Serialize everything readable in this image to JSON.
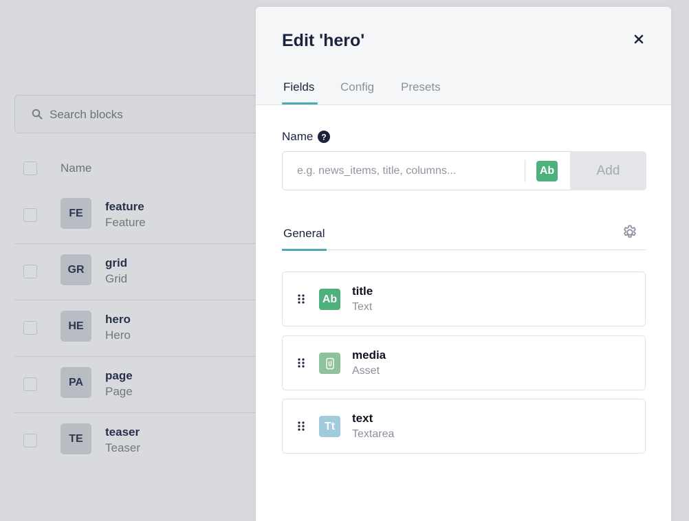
{
  "background": {
    "search": {
      "placeholder": "Search blocks"
    },
    "list_header": {
      "name_label": "Name"
    },
    "blocks": [
      {
        "badge": "FE",
        "name": "feature",
        "display_name": "Feature"
      },
      {
        "badge": "GR",
        "name": "grid",
        "display_name": "Grid"
      },
      {
        "badge": "HE",
        "name": "hero",
        "display_name": "Hero"
      },
      {
        "badge": "PA",
        "name": "page",
        "display_name": "Page"
      },
      {
        "badge": "TE",
        "name": "teaser",
        "display_name": "Teaser"
      }
    ]
  },
  "panel": {
    "title": "Edit 'hero'",
    "close_icon": "close-icon",
    "tabs": [
      {
        "label": "Fields",
        "active": true
      },
      {
        "label": "Config",
        "active": false
      },
      {
        "label": "Presets",
        "active": false
      }
    ],
    "name_field": {
      "label": "Name",
      "value": "",
      "placeholder": "e.g. news_items, title, columns...",
      "type_icon_text": "Ab",
      "add_label": "Add"
    },
    "section_tabs": [
      {
        "label": "General",
        "active": true
      }
    ],
    "fields": [
      {
        "name": "title",
        "type": "Text",
        "icon_text": "Ab",
        "icon": "text-icon",
        "color": "#4eb07c"
      },
      {
        "name": "media",
        "type": "Asset",
        "icon_text": "",
        "icon": "attachment-icon",
        "color": "#8dc29b"
      },
      {
        "name": "text",
        "type": "Textarea",
        "icon_text": "Tt",
        "icon": "textarea-icon",
        "color": "#9fcbdd"
      }
    ]
  },
  "colors": {
    "accent": "#4ea9b0",
    "text_green": "#4eb07c"
  }
}
